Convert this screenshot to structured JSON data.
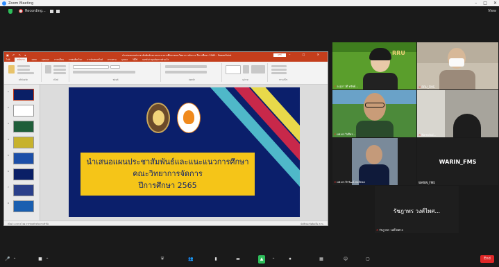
{
  "window": {
    "title": "Zoom Meeting",
    "controls": [
      "–",
      "□",
      "✕"
    ]
  },
  "topbar": {
    "recording_label": "Recording...",
    "view_label": "View"
  },
  "powerpoint": {
    "file_title": "นำเสนอแผนประชาสัมพันธ์และแนะแนวการศึกษาคณะวิทยาการจัดการ ปีการศึกษา 2565 - PowerPoint",
    "share_label": "แชร์",
    "tabs": [
      "ไฟล์",
      "หน้าแรก",
      "แทรก",
      "ออกแบบ",
      "การเปลี่ยน",
      "ภาพเคลื่อนไหว",
      "การนำเสนอสไลด์",
      "ตรวจทาน",
      "มุมมอง",
      "วิธีใช้",
      "บอกฉันว่าคุณต้องการทำอะไร"
    ],
    "active_tab": "หน้าแรก",
    "ribbon_groups": [
      "คลิปบอร์ด",
      "สไลด์",
      "ฟอนต์",
      "ย่อหน้า",
      "รูปวาด",
      "การแก้ไข"
    ],
    "slide_numbers": [
      "1",
      "2",
      "3",
      "4",
      "5",
      "6",
      "7",
      "8"
    ],
    "status_left": "สไลด์ 1 จาก 8   ไทย   การช่วยสำหรับการเข้าถึง",
    "status_right": "บันทึกย่อ   ข้อคิดเห็น   71%"
  },
  "slide": {
    "line1": "นำเสนอแผนประชาสัมพันธ์และแนะแนวการศึกษา",
    "line2": "คณะวิทยาการจัดการ",
    "line3": "ปีการศึกษา 2565",
    "colors": {
      "background": "#0b1f6b",
      "box": "#f5c518",
      "stripe1": "#4fb8c9",
      "stripe2": "#c8284a",
      "stripe3": "#e8d94a"
    }
  },
  "participants": [
    {
      "name": "อ.สุภาวดี ทรัพย์...",
      "banner": "RRU"
    },
    {
      "name": "RRU_FMS"
    },
    {
      "name": "ผศ.ดร.วิเชียร..."
    },
    {
      "name": "Kornchai..."
    },
    {
      "name": "ผศ.ดร.จิรวัฒน์ หงส์ทอง"
    },
    {
      "name": "WARIN_FMS",
      "display": "WARIN_FMS"
    },
    {
      "name": "รัชฎาพร วงศ์ไพศาล",
      "display": "รัชฎาพร วงศ์ไพศ..."
    }
  ],
  "toolbar": {
    "end_label": "End"
  }
}
